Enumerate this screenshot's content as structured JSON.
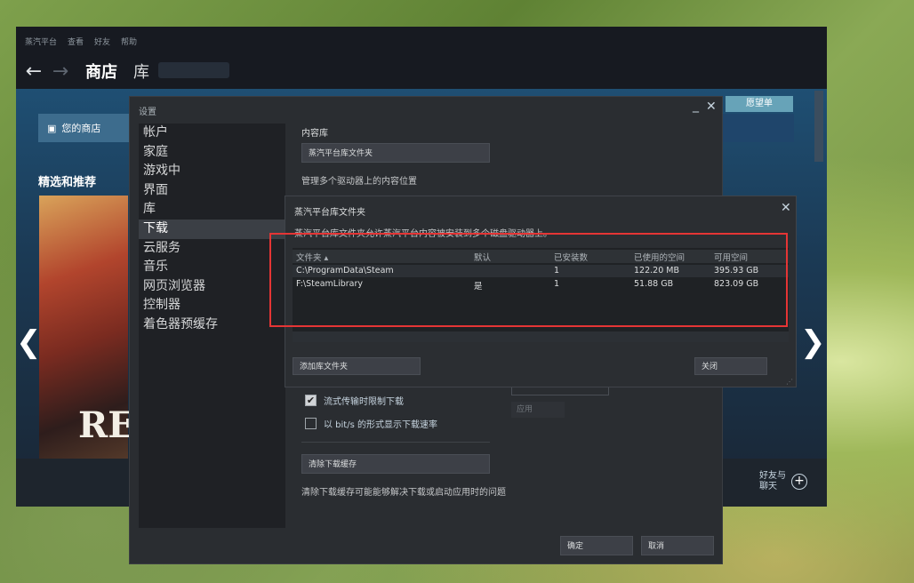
{
  "steam": {
    "menu": [
      "蒸汽平台",
      "查看",
      "好友",
      "帮助"
    ],
    "nav_back": "←",
    "nav_forward": "→",
    "tabs": [
      "商店",
      "库"
    ],
    "your_store": "您的商店",
    "wishlist": "愿望单",
    "featured": "精选和推荐",
    "hero_text": "RE",
    "arrow_left": "❮",
    "arrow_right": "❯",
    "friends_chat": "好友与聊天"
  },
  "settings": {
    "title": "设置",
    "minimize": "_",
    "close": "✕",
    "nav": [
      "帐户",
      "家庭",
      "游戏中",
      "界面",
      "库",
      "下载",
      "云服务",
      "音乐",
      "网页浏览器",
      "控制器",
      "着色器预缓存"
    ],
    "selected_nav": "下载",
    "section_title": "内容库",
    "library_button": "蒸汽平台库文件夹",
    "library_desc": "管理多个驱动器上的内容位置",
    "stream_throttle": "流式传输时限制下载",
    "stream_throttle_checked": true,
    "bits_display": "以 bit/s 的形式显示下载速率",
    "bits_display_checked": false,
    "apply": "应用",
    "clear_cache_button": "清除下载缓存",
    "clear_cache_desc": "清除下载缓存可能能够解决下载或启动应用时的问题",
    "ok": "确定",
    "cancel": "取消"
  },
  "library_dialog": {
    "title": "蒸汽平台库文件夹",
    "close": "✕",
    "desc": "蒸汽平台库文件夹允许蒸汽平台内容被安装到多个磁盘驱动器上。",
    "columns": {
      "folder": "文件夹 ▴",
      "default": "默认",
      "installed": "已安装数",
      "used": "已使用的空间",
      "free": "可用空间"
    },
    "rows": [
      {
        "folder": "C:\\ProgramData\\Steam",
        "default": "",
        "installed": "1",
        "used": "122.20 MB",
        "free": "395.93 GB"
      },
      {
        "folder": "F:\\SteamLibrary",
        "default": "是",
        "installed": "1",
        "used": "51.88 GB",
        "free": "823.09 GB"
      }
    ],
    "add_folder": "添加库文件夹",
    "close_button": "关闭"
  },
  "colors": {
    "highlight": "#e53535",
    "dialog_bg": "#2a2d31",
    "steam_dark": "#171a21"
  }
}
